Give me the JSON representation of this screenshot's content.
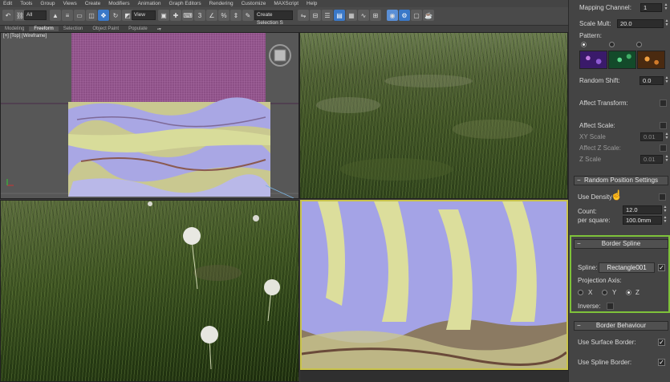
{
  "menu": [
    "Edit",
    "Tools",
    "Group",
    "Views",
    "Create",
    "Modifiers",
    "Animation",
    "Graph Editors",
    "Rendering",
    "Customize",
    "MAXScript",
    "Help"
  ],
  "toolbar": {
    "filter_value": "All",
    "view_value": "View",
    "selection_set_value": "Create Selection S"
  },
  "ribbon": {
    "tabs": [
      "Modeling",
      "Freeform",
      "Selection",
      "Object Paint",
      "Populate"
    ],
    "active": "Freeform"
  },
  "viewports": {
    "top_label": "[+] [Top] [Wireframe]"
  },
  "panel": {
    "mapping_channel_label": "Mapping Channel:",
    "mapping_channel_value": "1",
    "scale_mult_label": "Scale Mult:",
    "scale_mult_value": "20.0",
    "pattern_label": "Pattern:",
    "random_shift_label": "Random Shift:",
    "random_shift_value": "0.0",
    "affect_transform_label": "Affect Transform:",
    "affect_scale_label": "Affect Scale:",
    "xy_scale_label": "XY Scale",
    "xy_scale_value": "0.01",
    "affect_z_scale_label": "Affect Z Scale:",
    "z_scale_label": "Z Scale",
    "z_scale_value": "0.01",
    "random_position_title": "Random Position Settings",
    "use_density_label": "Use Density",
    "count_label": "Count:",
    "count_value": "12.0",
    "per_square_label": "per square:",
    "per_square_value": "100.0mm",
    "border_spline_title": "Border Spline",
    "spline_label": "Spline:",
    "spline_value": "Rectangle001",
    "projection_axis_label": "Projection Axis:",
    "axis_x": "X",
    "axis_y": "Y",
    "axis_z": "Z",
    "inverse_label": "Inverse:",
    "border_behaviour_title": "Border Behaviour",
    "use_surface_border_label": "Use Surface Border:",
    "use_spline_border_label": "Use Spline Border:"
  }
}
